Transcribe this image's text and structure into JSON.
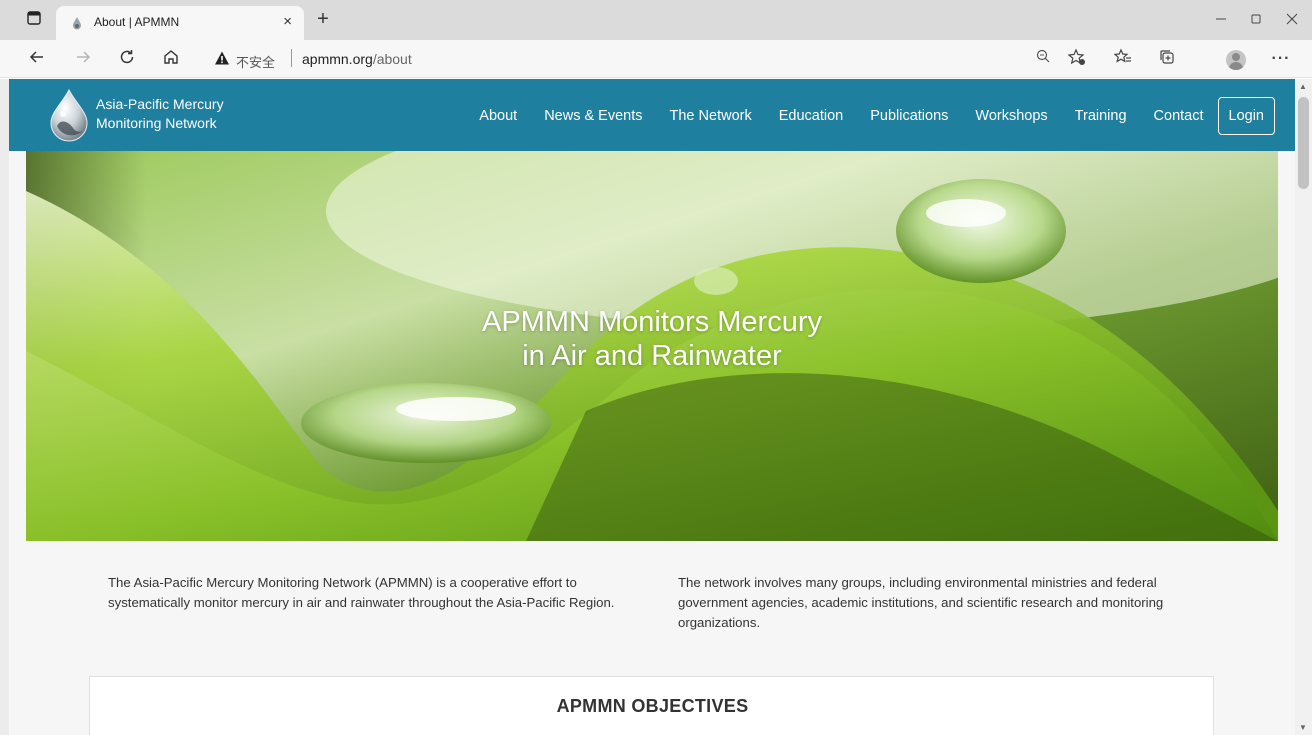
{
  "browser": {
    "tab_title": "About | APMMN",
    "tab_close": "×",
    "new_tab": "+",
    "address_insecure": "不安全",
    "address_host": "apmmn.org",
    "address_path": "/about"
  },
  "site": {
    "brand_line1": "Asia-Pacific Mercury",
    "brand_line2": "Monitoring Network",
    "nav": [
      "About",
      "News & Events",
      "The Network",
      "Education",
      "Publications",
      "Workshops",
      "Training",
      "Contact"
    ],
    "login": "Login",
    "hero_line1": "APMMN Monitors Mercury",
    "hero_line2": "in Air and Rainwater",
    "intro_left": "The Asia-Pacific Mercury Monitoring Network (APMMN) is a cooperative effort to systematically monitor mercury in air and rainwater throughout the Asia-Pacific Region.",
    "intro_right": "The network involves many groups, including environmental ministries and federal government agencies, academic institutions, and scientific research and monitoring organizations.",
    "objectives_title": "APMMN OBJECTIVES"
  },
  "colors": {
    "navbar": "#1f7f9f",
    "page_bg": "#f6f6f6",
    "hero_green": "#7fc12a"
  },
  "icons": [
    "tab-actions-icon",
    "favicon-drop-icon",
    "close-icon",
    "plus-icon",
    "minimize-icon",
    "maximize-icon",
    "back-icon",
    "forward-icon",
    "refresh-icon",
    "home-icon",
    "warning-icon",
    "zoom-icon",
    "add-favorite-icon",
    "favorites-icon",
    "collections-icon",
    "profile-icon",
    "more-icon",
    "mercury-drop-logo-icon"
  ]
}
